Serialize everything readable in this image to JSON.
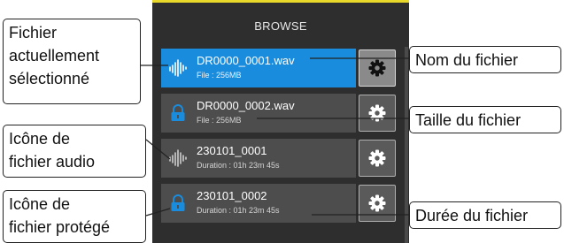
{
  "screen": {
    "title": "BROWSE",
    "accent_color": "#e7d82a",
    "selected_color": "#1a8cde",
    "files": [
      {
        "name": "DR0000_0001.wav",
        "detail": "File : 256MB",
        "icon": "audio-waveform-icon",
        "selected": true
      },
      {
        "name": "DR0000_0002.wav",
        "detail": "File : 256MB",
        "icon": "lock-icon",
        "selected": false
      },
      {
        "name": "230101_0001",
        "detail": "Duration : 01h 23m 45s",
        "icon": "audio-waveform-icon",
        "selected": false
      },
      {
        "name": "230101_0002",
        "detail": "Duration : 01h 23m 45s",
        "icon": "lock-icon",
        "selected": false
      }
    ],
    "gear_icon": "gear-icon"
  },
  "callouts": {
    "selected_file": [
      "Fichier",
      "actuellement",
      "sélectionné"
    ],
    "audio_icon": [
      "Icône de",
      "fichier audio"
    ],
    "protected_icon": [
      "Icône de",
      "fichier protégé"
    ],
    "file_name": "Nom du fichier",
    "file_size": "Taille du fichier",
    "file_duration": "Durée du fichier"
  }
}
